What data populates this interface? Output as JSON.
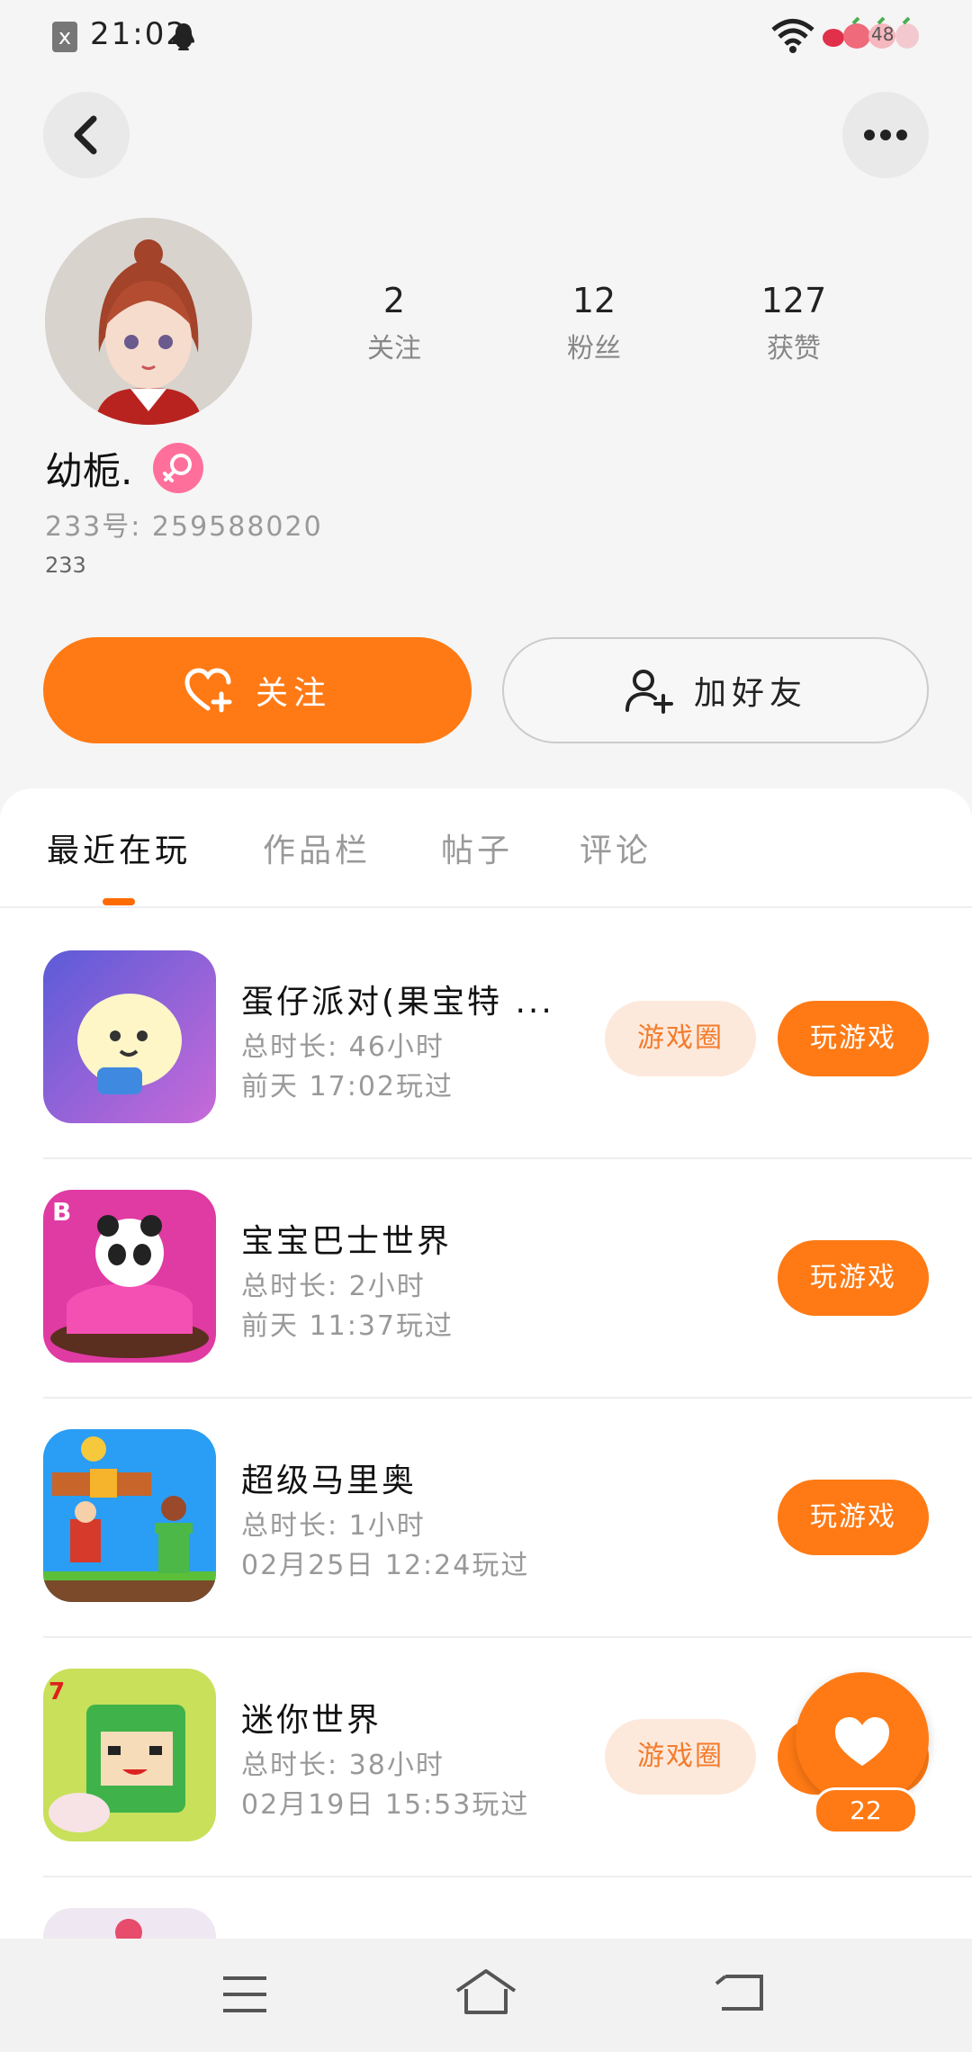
{
  "status_bar": {
    "time": "21:02",
    "battery": "48",
    "sim_icon": "x"
  },
  "profile": {
    "name": "幼栀.",
    "uid": "233号: 259588020",
    "bio": "233",
    "stats": [
      {
        "value": "2",
        "label": "关注"
      },
      {
        "value": "12",
        "label": "粉丝"
      },
      {
        "value": "127",
        "label": "获赞"
      }
    ]
  },
  "actions": {
    "follow": "关注",
    "add_friend": "加好友"
  },
  "tabs": [
    "最近在玩",
    "作品栏",
    "帖子",
    "评论"
  ],
  "games": [
    {
      "title": "蛋仔派对(果宝特 ...",
      "duration": "总时长: 46小时",
      "last_played": "前天 17:02玩过",
      "circle_label": "游戏圈",
      "play_label": "玩游戏"
    },
    {
      "title": "宝宝巴士世界",
      "duration": "总时长: 2小时",
      "last_played": "前天 11:37玩过",
      "circle_label": "",
      "play_label": "玩游戏"
    },
    {
      "title": "超级马里奥",
      "duration": "总时长: 1小时",
      "last_played": "02月25日 12:24玩过",
      "circle_label": "",
      "play_label": "玩游戏"
    },
    {
      "title": "迷你世界",
      "duration": "总时长: 38小时",
      "last_played": "02月19日 15:53玩过",
      "circle_label": "游戏圈",
      "play_label": "玩游戏"
    }
  ],
  "like_fab": {
    "count": "22"
  },
  "colors": {
    "accent": "#ff7a14",
    "accent_light": "#fde9dc",
    "gender": "#ff6f9c"
  },
  "icons": [
    "back-icon",
    "more-icon",
    "heart-plus-icon",
    "add-user-icon",
    "heart-icon",
    "menu-icon",
    "home-icon",
    "back-nav-icon",
    "wifi-icon",
    "battery-icon",
    "qq-icon",
    "female-icon"
  ]
}
